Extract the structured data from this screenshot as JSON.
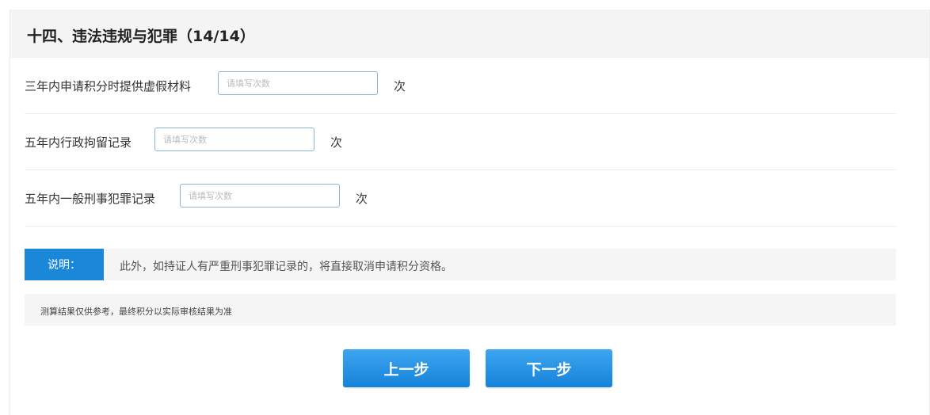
{
  "section": {
    "title": "十四、违法违规与犯罪（14/14）"
  },
  "fields": [
    {
      "label": "三年内申请积分时提供虚假材料",
      "placeholder": "请填写次数",
      "unit": "次"
    },
    {
      "label": "五年内行政拘留记录",
      "placeholder": "请填写次数",
      "unit": "次"
    },
    {
      "label": "五年内一般刑事犯罪记录",
      "placeholder": "请填写次数",
      "unit": "次"
    }
  ],
  "note": {
    "tag": "说明：",
    "text": "此外，如持证人有严重刑事犯罪记录的，将直接取消申请积分资格。"
  },
  "disclaimer": {
    "text": "测算结果仅供参考，最终积分以实际审核结果为准"
  },
  "buttons": {
    "prev_label": "上一步",
    "next_label": "下一步"
  },
  "colors": {
    "accent": "#1b87d9",
    "header_bg": "#f4f4f4",
    "input_border": "#8bb3cf"
  }
}
